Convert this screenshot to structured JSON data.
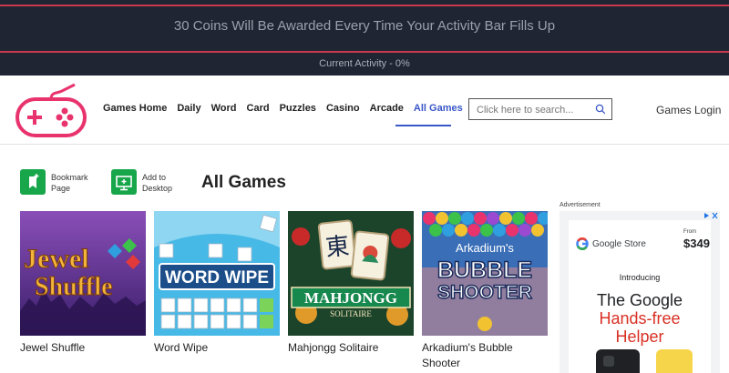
{
  "banner": {
    "coins_message": "30 Coins Will Be Awarded Every Time Your Activity Bar Fills Up",
    "activity": "Current Activity - 0%"
  },
  "nav": {
    "links": [
      "Games Home",
      "Daily",
      "Word",
      "Card",
      "Puzzles",
      "Casino",
      "Arcade",
      "All Games"
    ],
    "active": "All Games",
    "search_placeholder": "Click here to search...",
    "login": "Games Login"
  },
  "actions": {
    "bookmark": "Bookmark Page",
    "bookmark_l1": "Bookmark",
    "bookmark_l2": "Page",
    "desktop_l1": "Add to",
    "desktop_l2": "Desktop"
  },
  "page_title": "All Games",
  "games": [
    {
      "name": "Jewel Shuffle",
      "art_line1": "Jewel",
      "art_line2": "Shuffle"
    },
    {
      "name": "Word Wipe",
      "art_line1": "WORD WIPE"
    },
    {
      "name": "Mahjongg Solitaire",
      "art_line1": "MAHJONGG",
      "art_line2": "SOLITAIRE"
    },
    {
      "name": "Arkadium's Bubble Shooter",
      "art_line1": "Arkadium's",
      "art_line2": "BUBBLE",
      "art_line3": "SHOOTER"
    }
  ],
  "ad": {
    "label": "Advertisement",
    "store": "Google Store",
    "from": "From",
    "price": "$349",
    "introducing": "Introducing",
    "headline1": "The Google",
    "headline2": "Hands-free",
    "headline3": "Helper"
  },
  "colors": {
    "banner_bg": "#1f2532",
    "banner_accent": "#c8394f",
    "logo_pink": "#e8336d",
    "nav_active": "#3a57c9",
    "action_green": "#18a64b",
    "ad_red": "#d93025"
  }
}
